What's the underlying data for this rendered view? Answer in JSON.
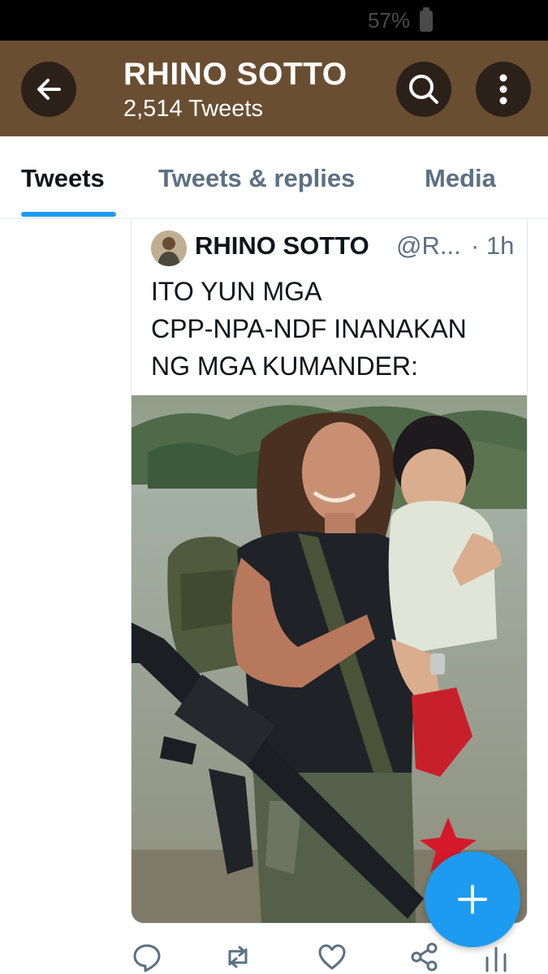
{
  "status_bar": {
    "battery": "57%"
  },
  "header": {
    "title": "RHINO SOTTO",
    "tweet_count": "2,514 Tweets",
    "icons": {
      "back": "arrow-left-icon",
      "search": "search-icon",
      "more": "more-vertical-icon"
    },
    "background_color": "#6a4e32"
  },
  "tabs": [
    {
      "label": "Tweets",
      "active": true
    },
    {
      "label": "Tweets & replies",
      "active": false
    },
    {
      "label": "Media",
      "active": false
    }
  ],
  "quoted_tweet": {
    "author_name": "RHINO SOTTO",
    "handle": "@R...",
    "time": "· 1h",
    "text_lines": [
      "ITO YUN MGA",
      "CPP-NPA-NDF INANAKAN",
      "NG MGA KUMANDER:"
    ]
  },
  "actions": [
    "reply-icon",
    "retweet-icon",
    "like-icon",
    "share-icon",
    "analytics-icon"
  ],
  "fab": {
    "icon": "plus-icon",
    "color": "#1d9bf0"
  },
  "accent_color": "#1d9bf0"
}
